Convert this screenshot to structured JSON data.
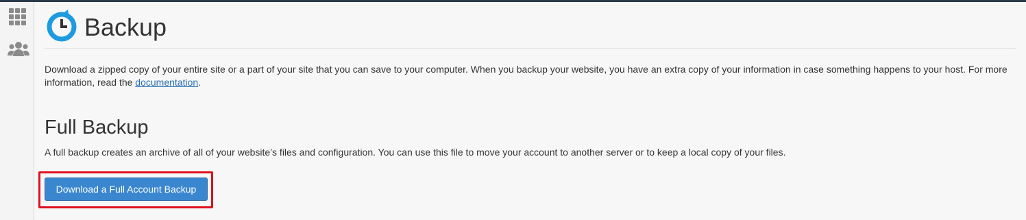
{
  "sidebar": {
    "items": [
      {
        "icon": "grid-icon",
        "label": ""
      },
      {
        "icon": "users-icon",
        "label": ""
      }
    ]
  },
  "header": {
    "title": "Backup",
    "icon": "backup-clock-icon"
  },
  "intro": {
    "text_before_link": "Download a zipped copy of your entire site or a part of your site that you can save to your computer. When you backup your website, you have an extra copy of your information in case something happens to your host. For more information, read the ",
    "link_text": "documentation",
    "text_after_link": "."
  },
  "full_backup": {
    "title": "Full Backup",
    "description": "A full backup creates an archive of all of your website’s files and configuration. You can use this file to move your account to another server or to keep a local copy of your files.",
    "button_label": "Download a Full Account Backup"
  },
  "colors": {
    "accent": "#3a87cf",
    "link": "#2a6fb5",
    "highlight": "#e0101e",
    "icon_blue": "#1e9be0",
    "sidebar_icon": "#8a8a8a"
  }
}
